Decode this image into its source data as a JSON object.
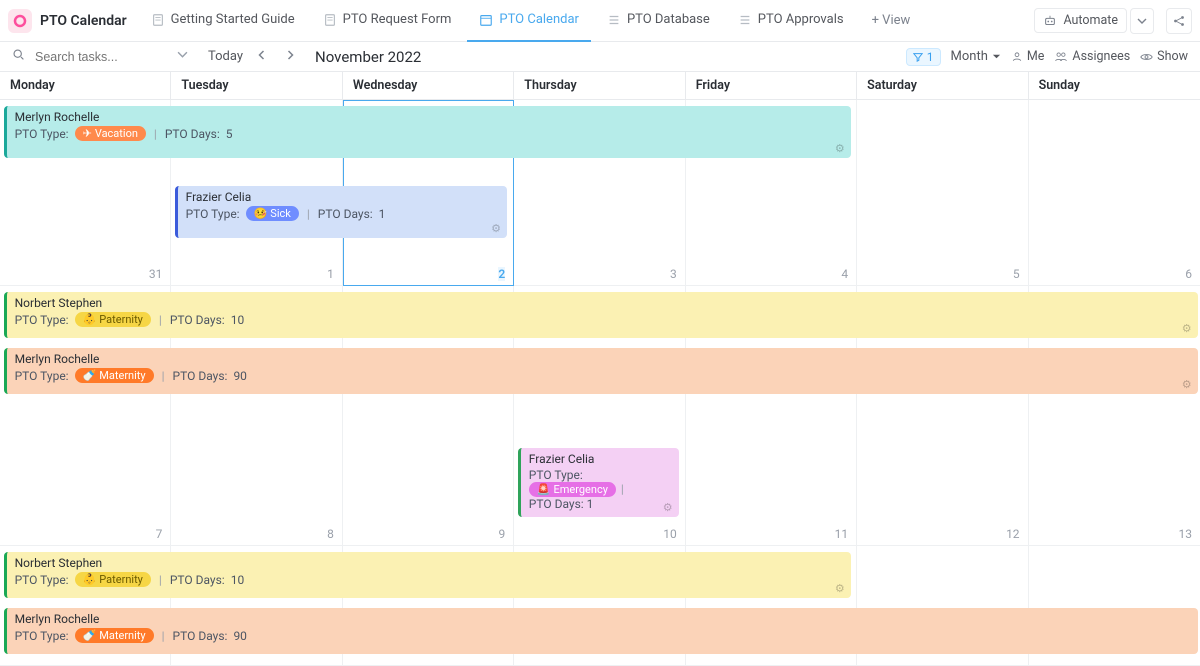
{
  "app": {
    "title": "PTO Calendar"
  },
  "tabs": {
    "t0": "Getting Started Guide",
    "t1": "PTO Request Form",
    "t2": "PTO Calendar",
    "t3": "PTO Database",
    "t4": "PTO Approvals",
    "add_view": "+ View"
  },
  "topbar": {
    "automate": "Automate",
    "share_label": "S"
  },
  "toolbar": {
    "search_placeholder": "Search tasks...",
    "today": "Today",
    "month_label": "November 2022",
    "filter_count": "1",
    "view_mode": "Month",
    "me": "Me",
    "assignees": "Assignees",
    "show": "Show"
  },
  "days": {
    "mon": "Monday",
    "tue": "Tuesday",
    "wed": "Wednesday",
    "thu": "Thursday",
    "fri": "Friday",
    "sat": "Saturday",
    "sun": "Sunday"
  },
  "dates": {
    "w1": [
      "31",
      "1",
      "2",
      "3",
      "4",
      "5",
      "6"
    ],
    "w2": [
      "7",
      "8",
      "9",
      "10",
      "11",
      "12",
      "13"
    ]
  },
  "labels": {
    "pto_type": "PTO Type:",
    "pto_days": "PTO Days:"
  },
  "badges": {
    "vacation": "Vacation",
    "sick": "Sick",
    "paternity": "Paternity",
    "maternity": "Maternity",
    "emergency": "Emergency"
  },
  "events": {
    "merlyn_vac": {
      "name": "Merlyn Rochelle",
      "days": "5"
    },
    "frazier_sick": {
      "name": "Frazier Celia",
      "days": "1"
    },
    "norbert_pat": {
      "name": "Norbert Stephen",
      "days": "10"
    },
    "merlyn_mat": {
      "name": "Merlyn Rochelle",
      "days": "90"
    },
    "frazier_emg": {
      "name": "Frazier Celia",
      "days": "1"
    }
  }
}
